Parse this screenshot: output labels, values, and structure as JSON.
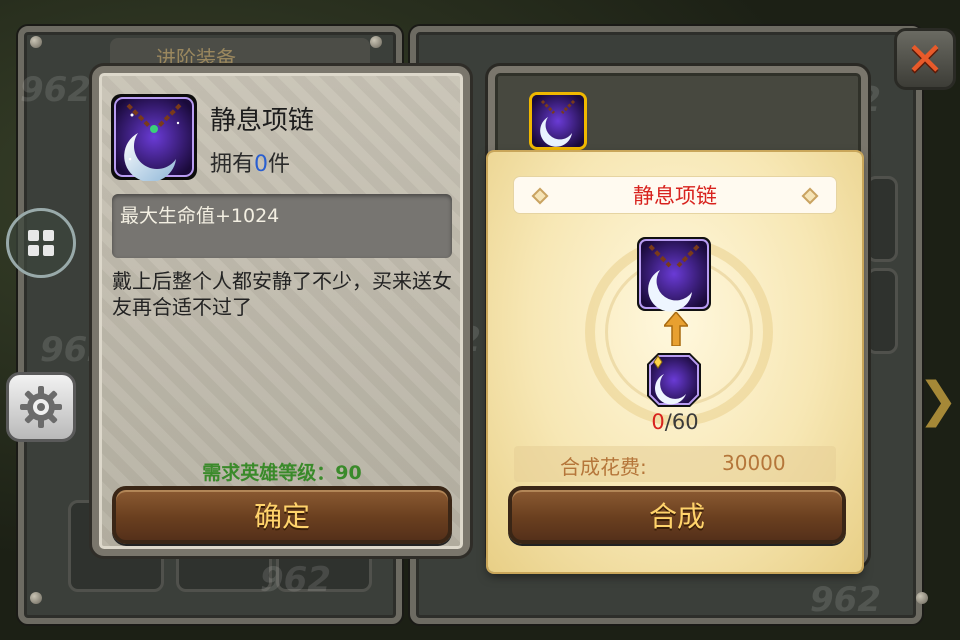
{
  "background": {
    "tab_label": "进阶装备"
  },
  "item_info": {
    "name": "静息项链",
    "owned_prefix": "拥有",
    "owned_count": "0",
    "owned_suffix": "件",
    "stat": "最大生命值+1024",
    "description": "戴上后整个人都安静了不少，买来送女友再合适不过了",
    "requirement": "需求英雄等级：90",
    "confirm_label": "确定"
  },
  "synthesis": {
    "title": "静息项链",
    "material_have": "0",
    "material_need": "/60",
    "cost_label": "合成花费:",
    "cost_value": "30000",
    "synth_label": "合成"
  },
  "controls": {
    "close_icon": "close-icon",
    "menu_icon": "grid-menu-icon",
    "settings_icon": "gear-icon",
    "next_icon": "chevron-right-icon"
  },
  "colors": {
    "accent_gold": "#ffd36b",
    "title_red": "#d8231e",
    "owned_blue": "#2a5fd0",
    "requirement_green": "#3a8a2a",
    "button_brown": "#6a3f1f"
  }
}
